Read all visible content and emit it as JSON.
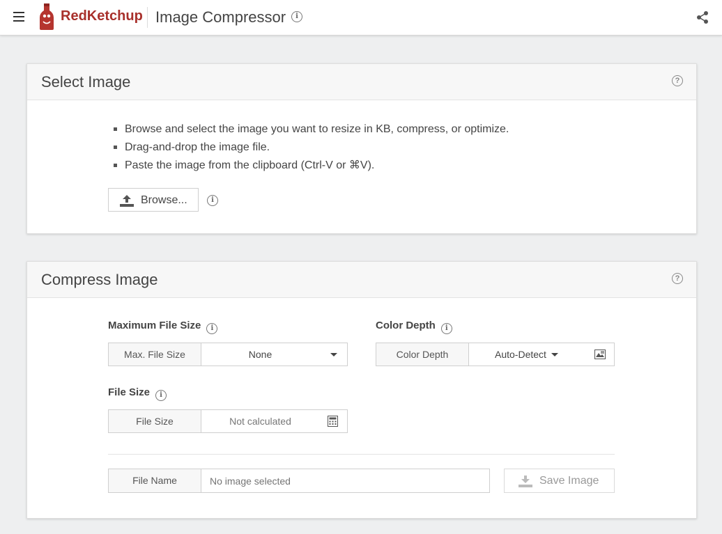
{
  "header": {
    "brand": "RedKetchup",
    "title": "Image Compressor",
    "title_info_glyph": "i",
    "colors": {
      "brand": "#a8302b"
    },
    "icons": [
      "menu-icon",
      "bottle-logo-icon",
      "info-icon",
      "share-icon"
    ]
  },
  "select_card": {
    "title": "Select Image",
    "help_glyph": "?",
    "instructions": [
      "Browse and select the image you want to resize in KB, compress, or optimize.",
      "Drag-and-drop the image file.",
      "Paste the image from the clipboard (Ctrl-V or ⌘V)."
    ],
    "browse_label": "Browse...",
    "browse_info_glyph": "i"
  },
  "compress_card": {
    "title": "Compress Image",
    "help_glyph": "?",
    "max_size": {
      "heading": "Maximum File Size",
      "addon": "Max. File Size",
      "value": "None",
      "info_glyph": "i"
    },
    "color_depth": {
      "heading": "Color Depth",
      "addon": "Color Depth",
      "value": "Auto-Detect",
      "info_glyph": "i"
    },
    "file_size": {
      "heading": "File Size",
      "addon": "File Size",
      "value": "Not calculated",
      "info_glyph": "i"
    },
    "file_name": {
      "addon": "File Name",
      "placeholder": "No image selected"
    },
    "save_label": "Save Image"
  }
}
